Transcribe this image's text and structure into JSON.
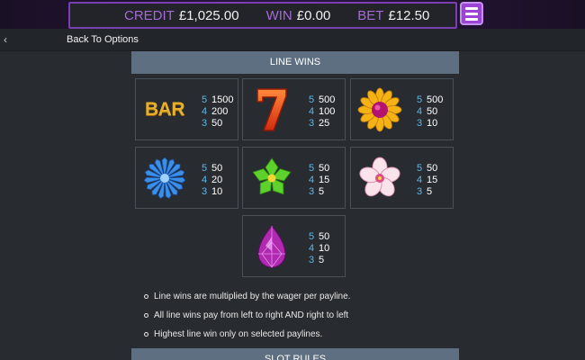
{
  "header": {
    "credit_label": "CREDIT",
    "credit_value": "£1,025.00",
    "win_label": "WIN",
    "win_value": "£0.00",
    "bet_label": "BET",
    "bet_value": "£12.50"
  },
  "nav": {
    "back_label": "Back To Options"
  },
  "line_wins": {
    "title": "LINE WINS",
    "symbols": [
      {
        "symbol": "BAR",
        "icon": "bar-icon",
        "pays": [
          {
            "count": "5",
            "amount": "1500"
          },
          {
            "count": "4",
            "amount": "200"
          },
          {
            "count": "3",
            "amount": "50"
          }
        ]
      },
      {
        "symbol": "7",
        "icon": "seven-icon",
        "pays": [
          {
            "count": "5",
            "amount": "500"
          },
          {
            "count": "4",
            "amount": "100"
          },
          {
            "count": "3",
            "amount": "25"
          }
        ]
      },
      {
        "symbol": "sunflower",
        "icon": "sunflower-icon",
        "pays": [
          {
            "count": "5",
            "amount": "500"
          },
          {
            "count": "4",
            "amount": "50"
          },
          {
            "count": "3",
            "amount": "10"
          }
        ]
      },
      {
        "symbol": "blue flower",
        "icon": "blue-flower-icon",
        "pays": [
          {
            "count": "5",
            "amount": "50"
          },
          {
            "count": "4",
            "amount": "20"
          },
          {
            "count": "3",
            "amount": "10"
          }
        ]
      },
      {
        "symbol": "green flower",
        "icon": "green-flower-icon",
        "pays": [
          {
            "count": "5",
            "amount": "50"
          },
          {
            "count": "4",
            "amount": "15"
          },
          {
            "count": "3",
            "amount": "5"
          }
        ]
      },
      {
        "symbol": "pink flower",
        "icon": "pink-flower-icon",
        "pays": [
          {
            "count": "5",
            "amount": "50"
          },
          {
            "count": "4",
            "amount": "15"
          },
          {
            "count": "3",
            "amount": "5"
          }
        ]
      },
      {
        "symbol": "purple gem",
        "icon": "purple-gem-icon",
        "pays": [
          {
            "count": "5",
            "amount": "50"
          },
          {
            "count": "4",
            "amount": "10"
          },
          {
            "count": "3",
            "amount": "5"
          }
        ]
      }
    ],
    "notes": [
      "Line wins are multiplied by the wager per payline.",
      "All line wins pay from left to right AND right to left",
      "Highest line win only on selected paylines."
    ]
  },
  "slot_rules": {
    "title": "SLOT RULES"
  },
  "colors": {
    "accent": "#9b44d6",
    "section_header": "#5d6f80",
    "count_blue": "#5db8e8",
    "background": "#282c31"
  }
}
